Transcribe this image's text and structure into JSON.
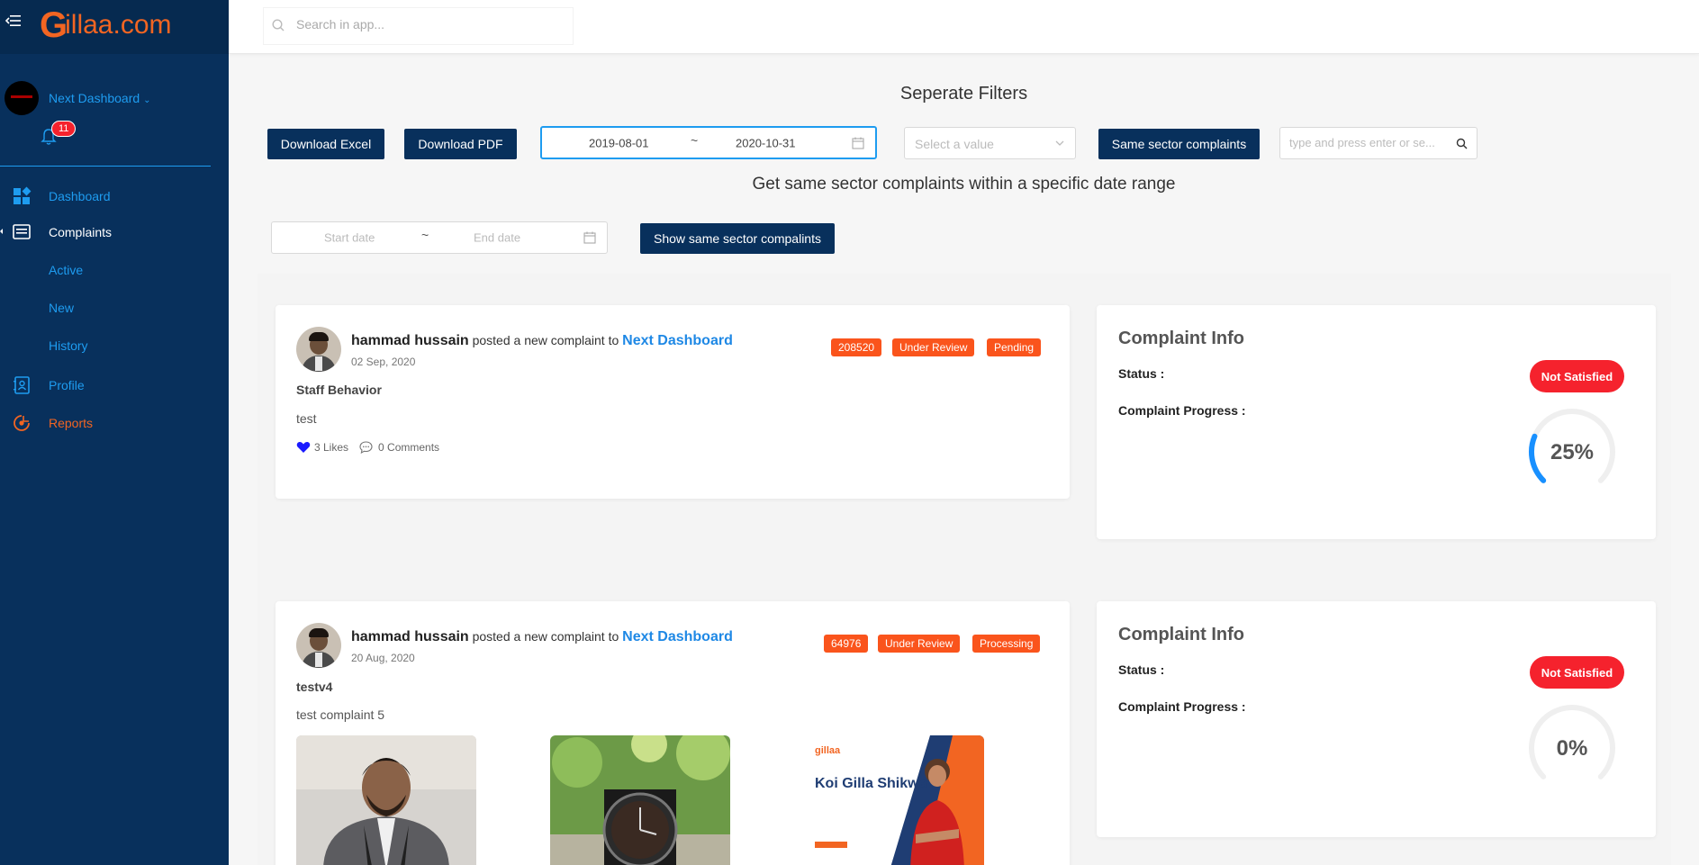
{
  "app": {
    "brand_g": "G",
    "brand_rest": "illaa.com",
    "search_placeholder": "Search in app..."
  },
  "sidebar": {
    "org_name": "Next Dashboard",
    "notification_count": "11",
    "items": [
      {
        "label": "Dashboard",
        "icon": "dashboard-icon"
      },
      {
        "label": "Complaints",
        "icon": "list-icon"
      },
      {
        "label": "Active"
      },
      {
        "label": "New"
      },
      {
        "label": "History"
      },
      {
        "label": "Profile",
        "icon": "contact-book-icon"
      },
      {
        "label": "Reports",
        "icon": "target-icon"
      }
    ]
  },
  "filters": {
    "title": "Seperate Filters",
    "download_excel": "Download Excel",
    "download_pdf": "Download PDF",
    "date_from": "2019-08-01",
    "date_to": "2020-10-31",
    "range_sep": "~",
    "select_placeholder": "Select a value",
    "same_sector_button": "Same sector complaints",
    "search_placeholder": "type and press enter or se...",
    "subtitle": "Get same sector complaints within a specific date range",
    "start_placeholder": "Start date",
    "end_placeholder": "End date",
    "show_button": "Show same sector compalints"
  },
  "complaints": [
    {
      "user": "hammad hussain",
      "action": " posted a new complaint to ",
      "target": "Next Dashboard",
      "date": "02 Sep, 2020",
      "tags": [
        "208520",
        "Under Review",
        "Pending"
      ],
      "category": "Staff Behavior",
      "body": "test",
      "likes": "3 Likes",
      "comments": "0 Comments",
      "info": {
        "title": "Complaint Info",
        "status_label": "Status :",
        "status": "Not Satisfied",
        "progress_label": "Complaint Progress :",
        "progress_text": "25%",
        "progress": 0.25
      }
    },
    {
      "user": "hammad hussain",
      "action": " posted a new complaint to ",
      "target": "Next Dashboard",
      "date": "20 Aug, 2020",
      "tags": [
        "64976",
        "Under Review",
        "Processing"
      ],
      "category": "testv4",
      "body": "test complaint 5",
      "poster_brand": "gillaa",
      "poster_text": "Koi Gilla Shikwa?",
      "info": {
        "title": "Complaint Info",
        "status_label": "Status :",
        "status": "Not Satisfied",
        "progress_label": "Complaint Progress :",
        "progress_text": "0%",
        "progress": 0
      }
    }
  ],
  "colors": {
    "sidebar": "#08305c",
    "accent_blue": "#1e9cf0",
    "brand_orange": "#f26522",
    "tag_orange": "#fa541c",
    "status_red": "#f5222d"
  }
}
